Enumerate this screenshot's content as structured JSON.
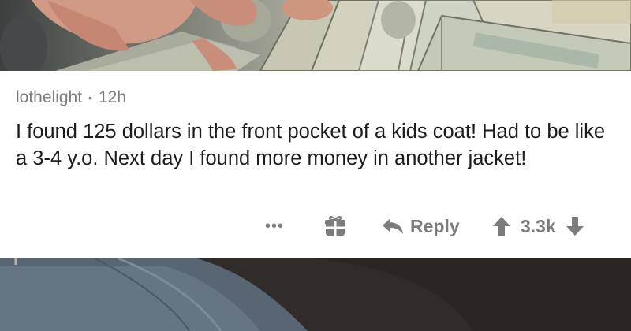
{
  "comment": {
    "username": "lothelight",
    "separator": "•",
    "age": "12h",
    "body": "I found 125 dollars in the front pocket of a kids coat! Had to be like a 3-4 y.o. Next day I found more money in another jacket!"
  },
  "actions": {
    "more_label": "•••",
    "more_icon": "ellipsis-icon",
    "award_icon": "gift-icon",
    "reply_icon": "reply-arrow-icon",
    "reply_label": "Reply",
    "upvote_icon": "upvote-arrow-icon",
    "score": "3.3k",
    "downvote_icon": "downvote-arrow-icon"
  },
  "colors": {
    "card_background": "#ffffff",
    "text": "#1c1c1c",
    "muted": "#7c7c7c"
  }
}
